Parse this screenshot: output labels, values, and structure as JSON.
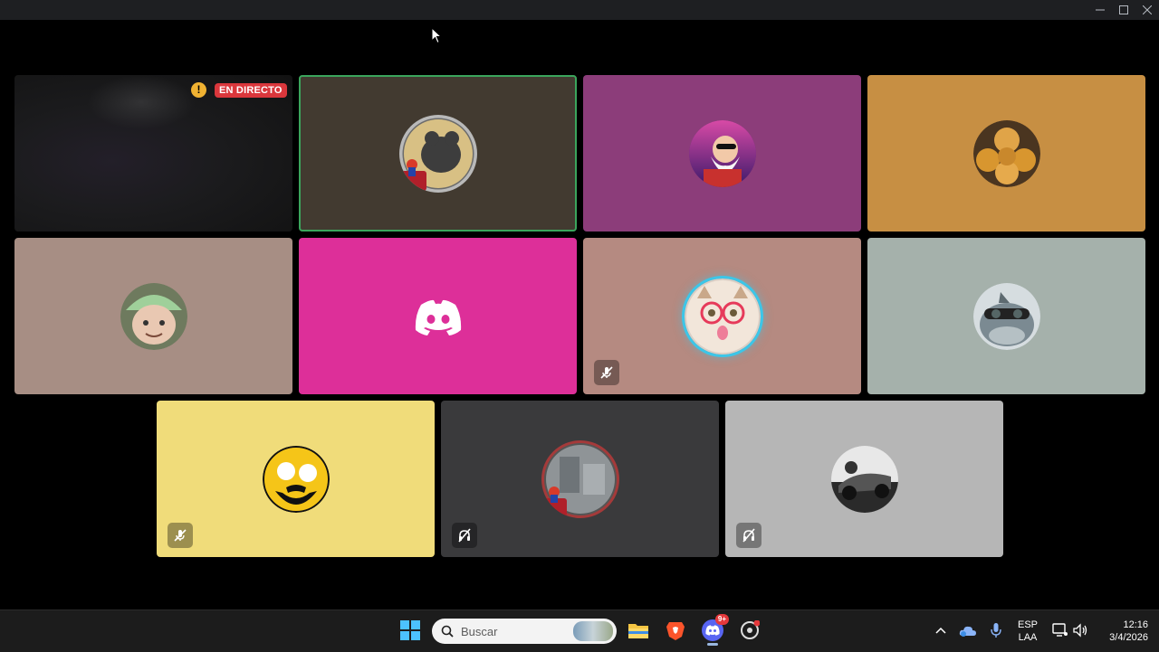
{
  "window": {
    "controls": {
      "minimize": "minimize-icon",
      "maximize": "maximize-icon",
      "close": "close-icon"
    }
  },
  "tiles": [
    {
      "id": "stream",
      "bg": "#161616",
      "live_label": "EN DIRECTO",
      "warning": "!",
      "muted": false
    },
    {
      "id": "user-mouse-frame",
      "bg": "#423a30",
      "active": true,
      "muted": false
    },
    {
      "id": "user-old-man",
      "bg": "#8c3d7a",
      "muted": false
    },
    {
      "id": "user-buns",
      "bg": "#c78f43",
      "muted": false
    },
    {
      "id": "user-cap",
      "bg": "#a78e84",
      "muted": false
    },
    {
      "id": "discord-default",
      "bg": "#dd2f99",
      "muted": false
    },
    {
      "id": "user-cat-glasses",
      "bg": "#b58a81",
      "muted": true,
      "speaking": true
    },
    {
      "id": "user-dolphin",
      "bg": "#a5b1ab",
      "muted": false
    },
    {
      "id": "user-yellow-face",
      "bg": "#f0dc7a",
      "muted": true
    },
    {
      "id": "user-frame-room",
      "bg": "#3a3a3c",
      "deafened": true
    },
    {
      "id": "user-car",
      "bg": "#b6b6b6",
      "deafened": true
    }
  ],
  "taskbar": {
    "search_label": "Buscar",
    "discord_badge": "9+",
    "language_line1": "ESP",
    "language_line2": "LAA",
    "time": "12:16",
    "date": "3/4/2026",
    "icons": [
      "windows-start-icon",
      "search-icon",
      "file-explorer-icon",
      "brave-browser-icon",
      "discord-icon",
      "app-icon",
      "chevron-up-icon",
      "onedrive-icon",
      "microphone-icon",
      "display-icon",
      "volume-icon"
    ]
  }
}
